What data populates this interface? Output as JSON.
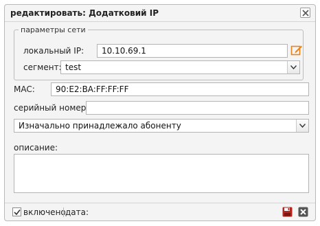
{
  "dialog": {
    "title": "редактировать: Додатковий IP",
    "close_icon": "close-icon"
  },
  "network_params": {
    "legend": "параметры сети",
    "local_ip_label": "локальный IP:",
    "local_ip_value": "10.10.69.1",
    "edit_icon": "pencil-edit-icon",
    "segment_label": "сегмент:",
    "segment_value": "test"
  },
  "mac": {
    "label": "MAC:",
    "value": "90:E2:BA:FF:FF:FF"
  },
  "serial": {
    "label": "серийный номер:",
    "value": ""
  },
  "ownership": {
    "value": "Изначально принадлежало абоненту"
  },
  "description": {
    "label": "описание:",
    "value": ""
  },
  "footer": {
    "enabled_label": "включено",
    "enabled_checked": true,
    "date_label": "дата:",
    "save_icon": "save-icon",
    "delete_icon": "delete-icon"
  },
  "colors": {
    "accent_orange": "#e8841a",
    "save_red": "#b3261e",
    "delete_gray": "#555555"
  }
}
